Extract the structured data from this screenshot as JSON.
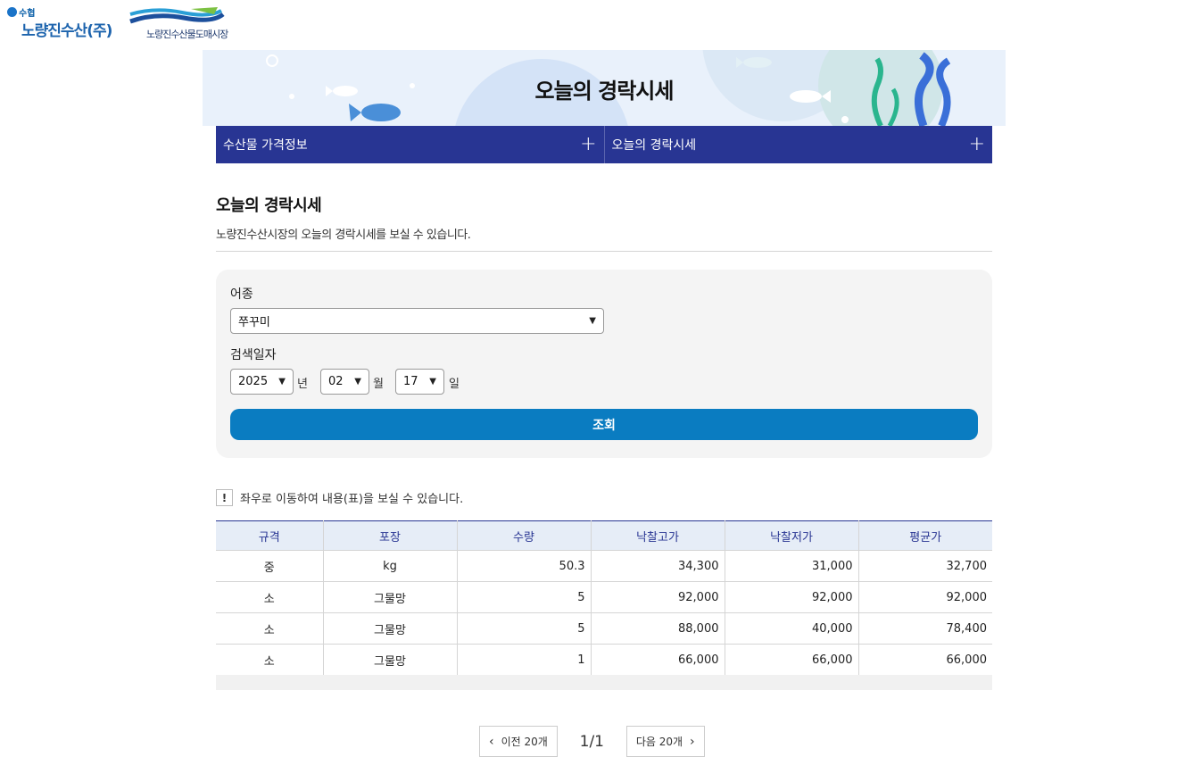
{
  "logos": {
    "suhyup": "수협",
    "company": "노량진수산(주)",
    "market": "노량진수산물도매시장"
  },
  "banner": {
    "title": "오늘의 경락시세"
  },
  "nav": {
    "items": [
      {
        "label": "수산물 가격정보",
        "icon": "plus-icon"
      },
      {
        "label": "오늘의 경락시세",
        "icon": "plus-icon"
      }
    ]
  },
  "page": {
    "title": "오늘의 경락시세",
    "description": "노량진수산시장의 오늘의 경락시세를 보실 수 있습니다."
  },
  "search": {
    "species_label": "어종",
    "species_value": "쭈꾸미",
    "date_label": "검색일자",
    "year_value": "2025",
    "year_unit": "년",
    "month_value": "02",
    "month_unit": "월",
    "day_value": "17",
    "day_unit": "일",
    "submit_label": "조회"
  },
  "notice": {
    "icon": "!",
    "text": "좌우로 이동하여 내용(표)을 보실 수 있습니다."
  },
  "table": {
    "headers": [
      "규격",
      "포장",
      "수량",
      "낙찰고가",
      "낙찰저가",
      "평균가"
    ],
    "rows": [
      [
        "중",
        "kg",
        "50.3",
        "34,300",
        "31,000",
        "32,700"
      ],
      [
        "소",
        "그물망",
        "5",
        "92,000",
        "92,000",
        "92,000"
      ],
      [
        "소",
        "그물망",
        "5",
        "88,000",
        "40,000",
        "78,400"
      ],
      [
        "소",
        "그물망",
        "1",
        "66,000",
        "66,000",
        "66,000"
      ]
    ]
  },
  "pagination": {
    "prev_label": "이전 20개",
    "current": "1/1",
    "next_label": "다음 20개"
  },
  "colors": {
    "nav_bg": "#283593",
    "button_bg": "#0a7cc1",
    "header_bg": "#e6edf7"
  }
}
